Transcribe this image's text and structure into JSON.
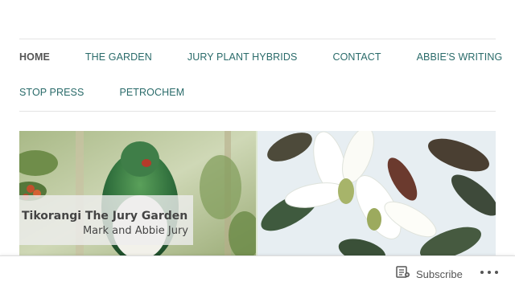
{
  "nav": {
    "row1": [
      {
        "label": "HOME",
        "active": true
      },
      {
        "label": "THE GARDEN"
      },
      {
        "label": "JURY PLANT HYBRIDS"
      },
      {
        "label": "CONTACT"
      },
      {
        "label": "ABBIE'S WRITING"
      }
    ],
    "row2": [
      {
        "label": "STOP PRESS"
      },
      {
        "label": "PETROCHEM"
      }
    ]
  },
  "banner": {
    "title": "Tikorangi The Jury Garden",
    "subtitle": "Mark and Abbie Jury"
  },
  "bottom_bar": {
    "subscribe_label": "Subscribe",
    "subscribe_icon": "reader-icon",
    "more_icon": "more-dots-icon"
  },
  "colors": {
    "nav_link": "#2a6b6a",
    "nav_active": "#555555",
    "rule": "#e4e4e4"
  }
}
